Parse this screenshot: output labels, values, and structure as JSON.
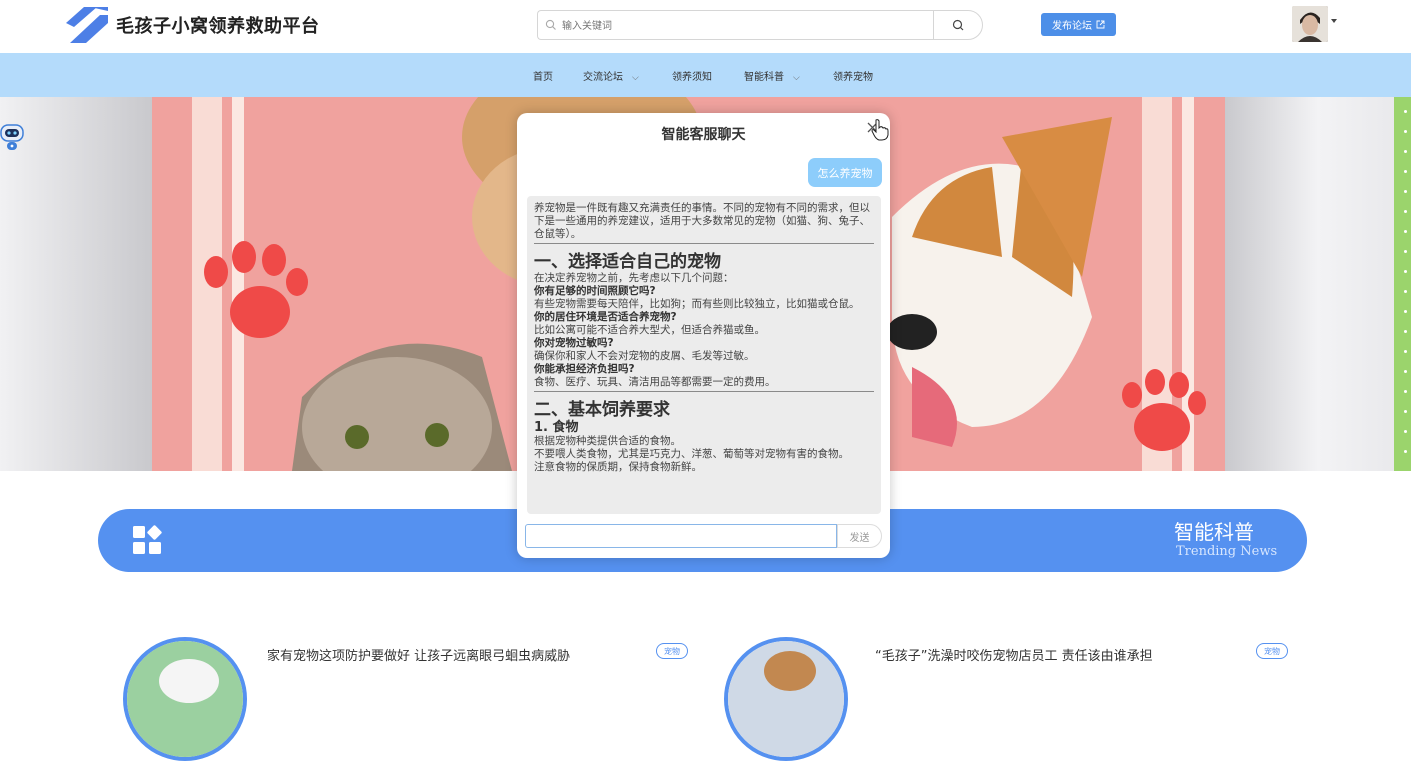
{
  "header": {
    "site_title": "毛孩子小窝领养救助平台",
    "search_placeholder": "输入关键词",
    "publish_label": "发布论坛"
  },
  "nav": {
    "items": [
      {
        "label": "首页",
        "has_dropdown": false
      },
      {
        "label": "交流论坛",
        "has_dropdown": true
      },
      {
        "label": "领养须知",
        "has_dropdown": false
      },
      {
        "label": "智能科普",
        "has_dropdown": true
      },
      {
        "label": "领养宠物",
        "has_dropdown": false
      }
    ]
  },
  "feature_bar": {
    "title": "智能科普",
    "subtitle": "Trending News"
  },
  "news": [
    {
      "title": "家有宠物这项防护要做好 让孩子远离眼弓蛔虫病威胁",
      "tag": "宠物"
    },
    {
      "title": "“毛孩子”洗澡时咬伤宠物店员工 责任该由谁承担",
      "tag": "宠物"
    }
  ],
  "chat": {
    "title": "智能客服聊天",
    "user_message": "怎么养宠物",
    "send_label": "发送",
    "bot": {
      "intro": "养宠物是一件既有趣又充满责任的事情。不同的宠物有不同的需求，但以下是一些通用的养宠建议，适用于大多数常见的宠物（如猫、狗、兔子、仓鼠等）。",
      "s1_title": "一、选择适合自己的宠物",
      "s1_lead": "在决定养宠物之前，先考虑以下几个问题：",
      "q1": "你有足够的时间照顾它吗?",
      "a1": "有些宠物需要每天陪伴，比如狗；而有些则比较独立，比如猫或仓鼠。",
      "q2": "你的居住环境是否适合养宠物?",
      "a2": "比如公寓可能不适合养大型犬，但适合养猫或鱼。",
      "q3": "你对宠物过敏吗?",
      "a3": "确保你和家人不会对宠物的皮屑、毛发等过敏。",
      "q4": "你能承担经济负担吗?",
      "a4": "食物、医疗、玩具、清洁用品等都需要一定的费用。",
      "s2_title": "二、基本饲养要求",
      "s2_sub": "1. 食物",
      "s2_l1": "根据宠物种类提供合适的食物。",
      "s2_l2": "不要喂人类食物，尤其是巧克力、洋葱、葡萄等对宠物有害的食物。",
      "s2_l3": "注意食物的保质期，保持食物新鲜。"
    }
  },
  "colors": {
    "primary": "#5591f0",
    "nav_bg": "#b4dbfb",
    "user_bubble": "#8dcdfb",
    "publish_btn": "#4d8fe8"
  },
  "icons": {
    "logo": "logo-mark-icon",
    "search": "search-icon",
    "external": "external-link-icon",
    "close": "close-icon",
    "robot": "robot-assistant-icon",
    "apps": "apps-grid-icon"
  }
}
